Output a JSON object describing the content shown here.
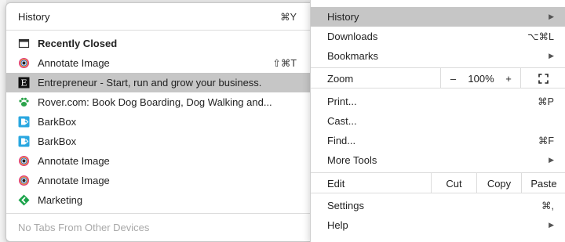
{
  "history_submenu": {
    "title": "History",
    "title_shortcut": "⌘Y",
    "recently_closed_label": "Recently Closed",
    "items": [
      {
        "label": "Annotate Image",
        "shortcut": "⇧⌘T",
        "icon": "annotate-image-favicon"
      },
      {
        "label": "Entrepreneur - Start, run and grow your business.",
        "shortcut": "",
        "icon": "entrepreneur-favicon"
      },
      {
        "label": "Rover.com: Book Dog Boarding, Dog Walking and...",
        "shortcut": "",
        "icon": "rover-paw-favicon"
      },
      {
        "label": "BarkBox",
        "shortcut": "",
        "icon": "barkbox-favicon"
      },
      {
        "label": "BarkBox",
        "shortcut": "",
        "icon": "barkbox-favicon"
      },
      {
        "label": "Annotate Image",
        "shortcut": "",
        "icon": "annotate-image-favicon"
      },
      {
        "label": "Annotate Image",
        "shortcut": "",
        "icon": "annotate-image-favicon"
      },
      {
        "label": "Marketing",
        "shortcut": "",
        "icon": "marketing-favicon"
      }
    ],
    "other_devices_label": "No Tabs From Other Devices"
  },
  "main_menu": {
    "history": {
      "label": "History",
      "arrow": "▶"
    },
    "downloads": {
      "label": "Downloads",
      "shortcut": "⌥⌘L"
    },
    "bookmarks": {
      "label": "Bookmarks",
      "arrow": "▶"
    },
    "zoom": {
      "label": "Zoom",
      "minus": "–",
      "level": "100%",
      "plus": "+"
    },
    "print": {
      "label": "Print...",
      "shortcut": "⌘P"
    },
    "cast": {
      "label": "Cast..."
    },
    "find": {
      "label": "Find...",
      "shortcut": "⌘F"
    },
    "more_tools": {
      "label": "More Tools",
      "arrow": "▶"
    },
    "edit": {
      "label": "Edit",
      "cut": "Cut",
      "copy": "Copy",
      "paste": "Paste"
    },
    "settings": {
      "label": "Settings",
      "shortcut": "⌘,"
    },
    "help": {
      "label": "Help",
      "arrow": "▶"
    }
  },
  "colors": {
    "highlight": "#c6c6c6",
    "barkbox_blue": "#2aa7e0",
    "rover_green": "#2ba34a",
    "marketing_green": "#1aa34a"
  }
}
